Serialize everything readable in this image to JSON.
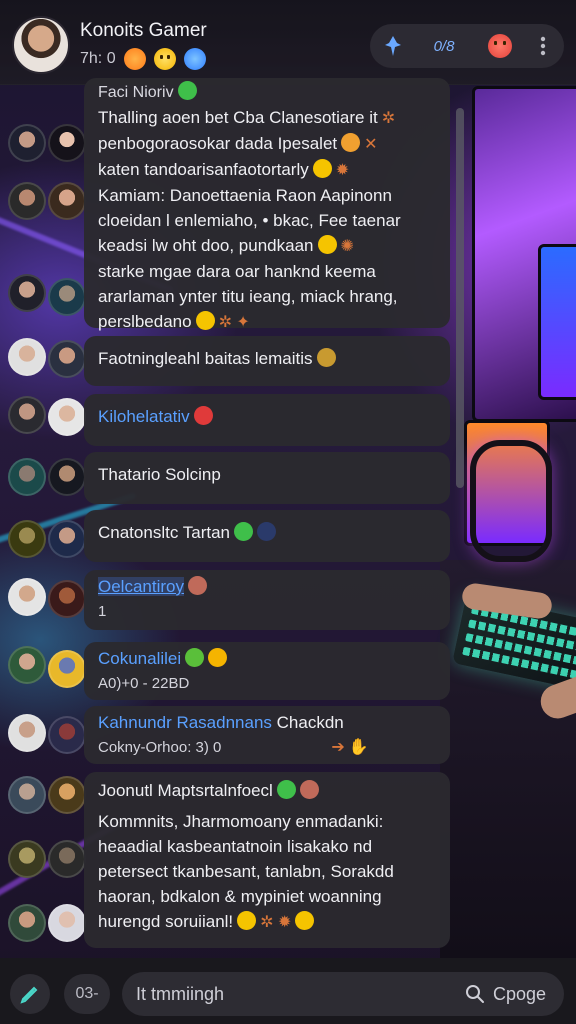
{
  "header": {
    "title": "Konoits Gamer",
    "subtitle": "7h: 0",
    "reaction_count": "0/8",
    "icons": [
      "pin-icon",
      "smiley-red-icon",
      "more-vertical-icon"
    ]
  },
  "messages": [
    {
      "lines": [
        "Faci Nioriv",
        "Thalling aoen bet Cba Clanesotiare it",
        "penbogoraosokar dada Ipesalet",
        "katen tandoarisanfaotortarly",
        "Kamiam: Danoettaenia Raon Aapinonn",
        "cloeidan l enlemiaho, • bkac, Fee taenar",
        "keadsi lw oht doo, pundkaan",
        "starke mgae dara oar hanknd keema",
        "ararlaman ynter titu ieang, miack hrang,",
        "perslbedano"
      ]
    },
    {
      "lines": [
        "Faotningleahl baitas lemaitis"
      ]
    },
    {
      "sender": "Kilohelatativ"
    },
    {
      "lines": [
        "Thatario Solcinp"
      ]
    },
    {
      "lines": [
        "Cnatonsltc Tartan"
      ]
    },
    {
      "sender": "Oelcantiroy",
      "meta": "1"
    },
    {
      "sender": "Cokunalilei",
      "meta": "A0)+0 - 22BD"
    },
    {
      "sender": "Kahnundr Rasadnnans",
      "suffix": " Chackdn",
      "meta": "Cokny-Orhoo: 3) 0"
    },
    {
      "title": "Joonutl Maptsrtalnfoecl",
      "lines": [
        "Kommnits, Jharmomoany  enmadanki:",
        "heaadial kasbeantatnoin lisakako nd",
        "petersect tkanbesant, tanlabn, Sorakdd",
        "haoran, bdkalon & mypiniet woanning",
        "hurengd soruiianl!"
      ]
    }
  ],
  "footer": {
    "counter": "03-",
    "input_placeholder": "It tmmiingh",
    "search_label": "Cpoge"
  },
  "colors": {
    "accent": "#5aa0ff",
    "bubble": "#2b2a2f",
    "header": "#1e1b24"
  }
}
